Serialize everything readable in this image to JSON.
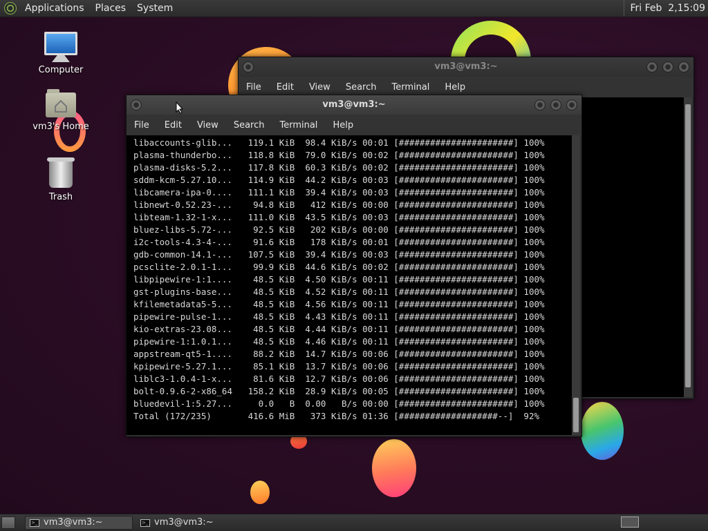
{
  "top_panel": {
    "menus": [
      "Applications",
      "Places",
      "System"
    ],
    "clock": "Fri Feb  2,15:09"
  },
  "desktop": {
    "icons": [
      {
        "label": "Computer",
        "icon": "computer-icon"
      },
      {
        "label": "vm3's Home",
        "icon": "home-folder-icon"
      },
      {
        "label": "Trash",
        "icon": "trash-icon"
      }
    ]
  },
  "back_window": {
    "title": "vm3@vm3:~",
    "menu": [
      "File",
      "Edit",
      "View",
      "Search",
      "Terminal",
      "Help"
    ]
  },
  "front_window": {
    "title": "vm3@vm3:~",
    "menu": [
      "File",
      "Edit",
      "View",
      "Search",
      "Terminal",
      "Help"
    ],
    "lines": [
      "libaccounts-glib...   119.1 KiB  98.4 KiB/s 00:01 [######################] 100%",
      "plasma-thunderbo...   118.8 KiB  79.0 KiB/s 00:02 [######################] 100%",
      "plasma-disks-5.2...   117.8 KiB  60.3 KiB/s 00:02 [######################] 100%",
      "sddm-kcm-5.27.10...   114.9 KiB  44.2 KiB/s 00:03 [######################] 100%",
      "libcamera-ipa-0....   111.1 KiB  39.4 KiB/s 00:03 [######################] 100%",
      "libnewt-0.52.23-...    94.8 KiB   412 KiB/s 00:00 [######################] 100%",
      "libteam-1.32-1-x...   111.0 KiB  43.5 KiB/s 00:03 [######################] 100%",
      "bluez-libs-5.72-...    92.5 KiB   202 KiB/s 00:00 [######################] 100%",
      "i2c-tools-4.3-4-...    91.6 KiB   178 KiB/s 00:01 [######################] 100%",
      "gdb-common-14.1-...   107.5 KiB  39.4 KiB/s 00:03 [######################] 100%",
      "pcsclite-2.0.1-1...    99.9 KiB  44.6 KiB/s 00:02 [######################] 100%",
      "libpipewire-1:1....    48.5 KiB  4.50 KiB/s 00:11 [######################] 100%",
      "gst-plugins-base...    48.5 KiB  4.52 KiB/s 00:11 [######################] 100%",
      "kfilemetadata5-5...    48.5 KiB  4.56 KiB/s 00:11 [######################] 100%",
      "pipewire-pulse-1...    48.5 KiB  4.43 KiB/s 00:11 [######################] 100%",
      "kio-extras-23.08...    48.5 KiB  4.44 KiB/s 00:11 [######################] 100%",
      "pipewire-1:1.0.1...    48.5 KiB  4.46 KiB/s 00:11 [######################] 100%",
      "appstream-qt5-1....    88.2 KiB  14.7 KiB/s 00:06 [######################] 100%",
      "kpipewire-5.27.1...    85.1 KiB  13.7 KiB/s 00:06 [######################] 100%",
      "liblc3-1.0.4-1-x...    81.6 KiB  12.7 KiB/s 00:06 [######################] 100%",
      "bolt-0.9.6-2-x86_64   158.2 KiB  28.9 KiB/s 00:05 [######################] 100%",
      "bluedevil-1:5.27...     0.0   B  0.00   B/s 00:00 [######################] 100%",
      "Total (172/235)       416.6 MiB   373 KiB/s 01:36 [###################--]  92%"
    ]
  },
  "taskbar": {
    "tasks": [
      {
        "label": "vm3@vm3:~",
        "active": true
      },
      {
        "label": "vm3@vm3:~",
        "active": false
      }
    ]
  },
  "colors": {
    "wallpaper": "#2a0d24",
    "terminal_bg": "#000000",
    "terminal_fg": "#d8d8d8"
  }
}
